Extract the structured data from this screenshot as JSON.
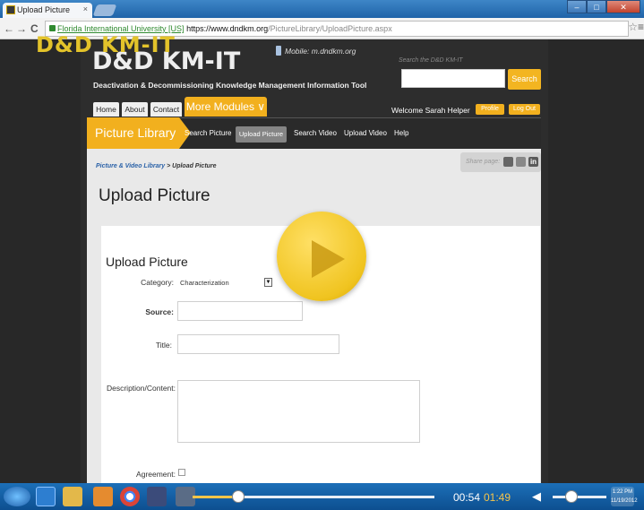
{
  "browser": {
    "tab_title": "Upload Picture",
    "tab_close": "×",
    "secure_label": "Florida International University [US]",
    "url_host": "https://www.dndkm.org",
    "url_path": "/PictureLibrary/UploadPicture.aspx",
    "back": "←",
    "forward": "→",
    "reload": "C",
    "star": "☆",
    "menu": "≡",
    "win_min": "–",
    "win_max": "□",
    "win_close": "✕"
  },
  "site": {
    "watermark": "D&D KM-IT",
    "logo": "D&D KM-IT",
    "tagline": "Deactivation & Decommissioning Knowledge Management Information Tool",
    "mobile_link": "Mobile: m.dndkm.org",
    "search_hint": "Search the D&D KM-IT",
    "search_button": "Search",
    "top_nav": [
      "Home",
      "About",
      "Contact"
    ],
    "more_modules": "More Modules ∨",
    "welcome": "Welcome Sarah Helper",
    "profile_button": "Profile",
    "logout_button": "Log Out"
  },
  "module_nav": {
    "title": "Picture Library",
    "items": [
      "Search Picture",
      "Upload Picture",
      "Search Video",
      "Upload Video",
      "Help"
    ],
    "active_index": 1
  },
  "content": {
    "breadcrumb_link": "Picture & Video Library",
    "breadcrumb_sep": " > ",
    "breadcrumb_current": "Upload Picture",
    "share_label": "Share page:",
    "share_linkedin": "in",
    "page_title": "Upload Picture",
    "form_heading": "Upload Picture",
    "labels": {
      "category": "Category:",
      "source": "Source:",
      "title": "Title:",
      "description": "Description/Content:",
      "agreement": "Agreement:"
    },
    "category_value": "Characterization",
    "source_value": "",
    "title_value": "",
    "description_value": ""
  },
  "player": {
    "time_elapsed": "00:54",
    "time_total": "01:49",
    "progress": 0.19,
    "volume_icon": "◀",
    "volume_level": 0.35,
    "clock": "1:22 PM 11/19/2012"
  },
  "colors": {
    "accent": "#f2b01e",
    "link": "#2b62a8",
    "taskbar": "#1c6fb8"
  }
}
